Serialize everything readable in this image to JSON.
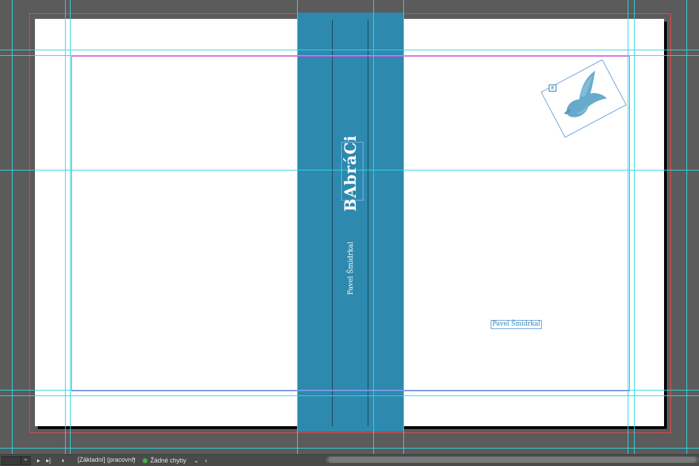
{
  "spine": {
    "title": "BAbráCi",
    "author": "Pavel Šmidrkal"
  },
  "back_cover": {
    "author": "Pavel Šmidrkal"
  },
  "image": {
    "icon": "dove-icon",
    "link_badge": "8"
  },
  "statusbar": {
    "preset": "[Základní] (pracovní)",
    "preflight": "Žádné chyby"
  },
  "colors": {
    "spine": "#2e89ae",
    "guides": "#2fd8e3",
    "bleed": "#e8494a",
    "margin": "#d253e0",
    "preflight_ok": "#43b243"
  }
}
